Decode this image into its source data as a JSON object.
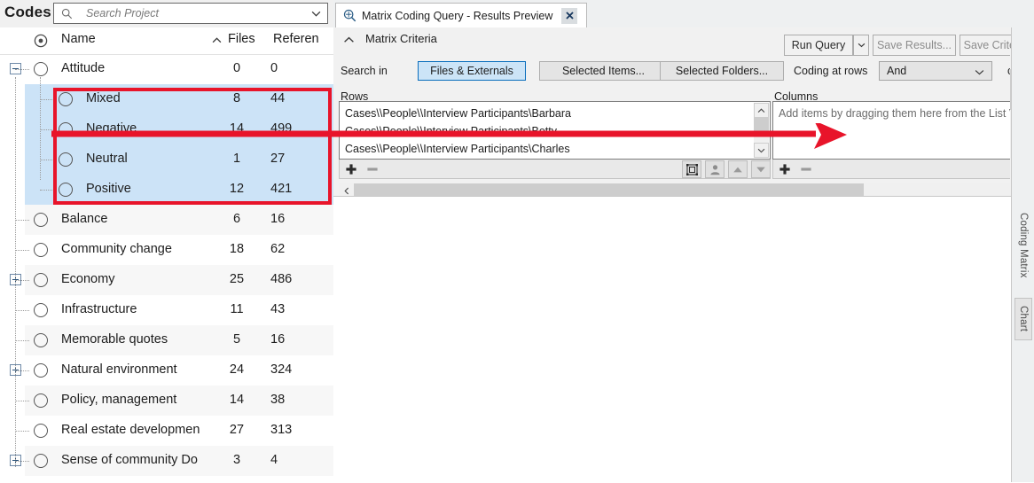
{
  "left": {
    "title": "Codes",
    "search": {
      "placeholder": "Search Project",
      "value": ""
    },
    "columns": {
      "name": "Name",
      "files": "Files",
      "references": "Referen"
    },
    "rows": [
      {
        "label": "Attitude",
        "files": "0",
        "references": "0",
        "level": 0,
        "expander": "minus",
        "selected": false
      },
      {
        "label": "Mixed",
        "files": "8",
        "references": "44",
        "level": 1,
        "expander": "none",
        "selected": true
      },
      {
        "label": "Negative",
        "files": "14",
        "references": "499",
        "level": 1,
        "expander": "none",
        "selected": true
      },
      {
        "label": "Neutral",
        "files": "1",
        "references": "27",
        "level": 1,
        "expander": "none",
        "selected": true
      },
      {
        "label": "Positive",
        "files": "12",
        "references": "421",
        "level": 1,
        "expander": "none",
        "selected": true
      },
      {
        "label": "Balance",
        "files": "6",
        "references": "16",
        "level": 0,
        "expander": "none",
        "selected": false
      },
      {
        "label": "Community change",
        "files": "18",
        "references": "62",
        "level": 0,
        "expander": "none",
        "selected": false
      },
      {
        "label": "Economy",
        "files": "25",
        "references": "486",
        "level": 0,
        "expander": "plus",
        "selected": false
      },
      {
        "label": "Infrastructure",
        "files": "11",
        "references": "43",
        "level": 0,
        "expander": "none",
        "selected": false
      },
      {
        "label": "Memorable quotes",
        "files": "5",
        "references": "16",
        "level": 0,
        "expander": "none",
        "selected": false
      },
      {
        "label": "Natural environment",
        "files": "24",
        "references": "324",
        "level": 0,
        "expander": "plus",
        "selected": false
      },
      {
        "label": "Policy, management",
        "files": "14",
        "references": "38",
        "level": 0,
        "expander": "none",
        "selected": false
      },
      {
        "label": "Real estate developmen",
        "files": "27",
        "references": "313",
        "level": 0,
        "expander": "none",
        "selected": false
      },
      {
        "label": "Sense of community Do",
        "files": "3",
        "references": "4",
        "level": 0,
        "expander": "plus",
        "selected": false
      }
    ]
  },
  "right": {
    "tab": {
      "label": "Matrix Coding Query - Results Preview",
      "close": "✕"
    },
    "criteria": {
      "title": "Matrix Criteria",
      "buttons": {
        "run_query": "Run Query",
        "run_query_arrow": "▾",
        "save_results": "Save Results...",
        "save_criteria": "Save Criteria..."
      },
      "search_in_label": "Search in",
      "search_in_options": [
        "Files & Externals",
        "Selected Items...",
        "Selected Folders..."
      ],
      "search_in_selected": "Files & Externals",
      "coding_at_rows_label": "Coding at rows",
      "coding_operator": "And",
      "coding_at_columns_label": "colu",
      "rows_label": "Rows",
      "columns_label": "Columns",
      "rows_items": [
        "Cases\\\\People\\\\Interview Participants\\Barbara",
        "Cases\\\\People\\\\Interview Participants\\Betty",
        "Cases\\\\People\\\\Interview Participants\\Charles"
      ],
      "columns_placeholder": "Add items by dragging them here from the List View o",
      "toolbar": {
        "add": "+",
        "remove": "−",
        "select_item": "select-item",
        "select_case": "select-case",
        "move_up": "▲",
        "move_down": "▼"
      }
    },
    "vertical_tabs": [
      "Coding Matrix",
      "Chart"
    ]
  },
  "annotations": {
    "highlight_color": "#e8142a",
    "arrow_color": "#e8142a",
    "selection_color": "#cce3f7",
    "accent_color": "#0a6ebd"
  }
}
